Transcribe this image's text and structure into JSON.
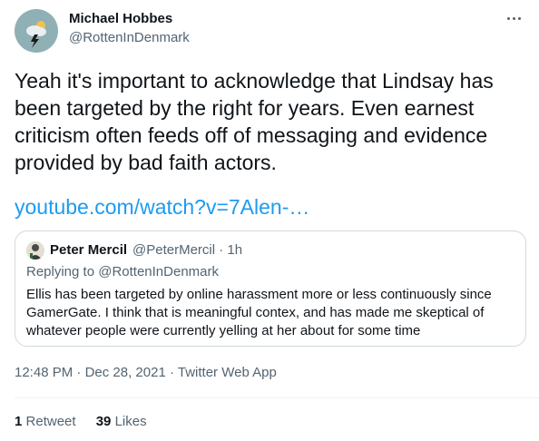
{
  "author": {
    "name": "Michael Hobbes",
    "handle": "@RottenInDenmark",
    "avatar_icon": "storm-cloud-icon"
  },
  "more_icon": "more-dots-icon",
  "tweet": {
    "text": "Yeah it's important to acknowledge that Lindsay has been targeted by the right for years. Even earnest criticism often feeds off of messaging and evidence provided by bad faith actors.",
    "link": "youtube.com/watch?v=7Alen-…"
  },
  "quoted": {
    "name": "Peter Mercil",
    "handle": "@PeterMercil",
    "separator": "·",
    "time": "1h",
    "replying_prefix": "Replying to",
    "replying_to": "@RottenInDenmark",
    "text": "Ellis has been targeted by online harassment more or less continuously since GamerGate. I think that is meaningful contex, and has made me skeptical of whatever people were currently yelling at her about for some time"
  },
  "meta": {
    "time": "12:48 PM",
    "date": "Dec 28, 2021",
    "separator": "·",
    "source": "Twitter Web App"
  },
  "stats": {
    "retweets": "1",
    "retweets_label": "Retweet",
    "likes": "39",
    "likes_label": "Likes"
  },
  "colors": {
    "link": "#1d9bf0",
    "secondary_text": "#536471",
    "border": "#cfd9de"
  }
}
